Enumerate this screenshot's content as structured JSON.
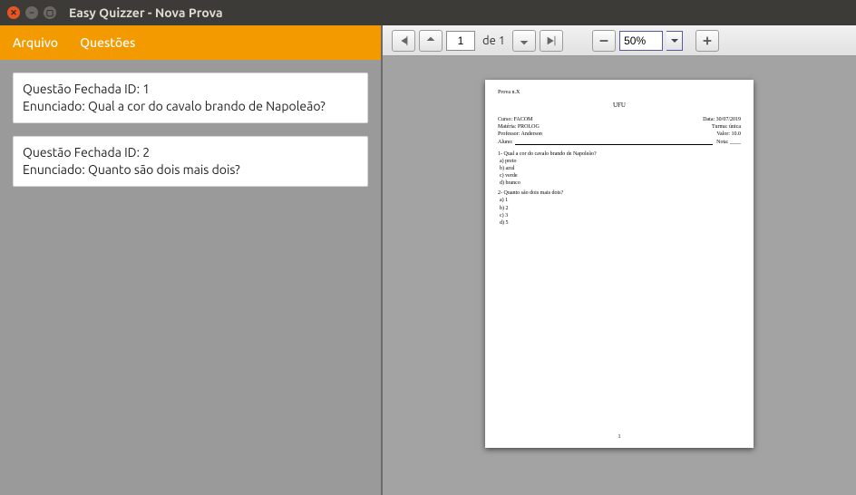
{
  "window": {
    "title": "Easy Quizzer - Nova Prova"
  },
  "menu": {
    "arquivo": "Arquivo",
    "questoes": "Questões"
  },
  "questions": [
    {
      "id_line": "Questão Fechada ID: 1",
      "enun": "Enunciado: Qual a cor do cavalo brando de Napoleão?"
    },
    {
      "id_line": "Questão Fechada ID: 2",
      "enun": "Enunciado: Quanto são dois mais dois?"
    }
  ],
  "viewer": {
    "page_input": "1",
    "page_total": "de 1",
    "zoom": "50%"
  },
  "doc": {
    "top": "Prova n.X",
    "header": "UFU",
    "curso": "Curso: FACOM",
    "data": "Data: 30/07/2019",
    "materia": "Matéria: PROLOG",
    "turma": "Turma: única",
    "professor": "Professor: Anderson",
    "valor": "Valor: 10.0",
    "aluno": "Aluno:",
    "nota": "Nota: ____",
    "q1": "1- Qual a cor do cavalo brando de Napoleão?",
    "q1a": "a) preto",
    "q1b": "b) azul",
    "q1c": "c) verde",
    "q1d": "d) branco",
    "q2": "2- Quanto são dois mais dois?",
    "q2a": "a) 1",
    "q2b": "b) 2",
    "q2c": "c) 3",
    "q2d": "d) 5",
    "pagenum": "1"
  }
}
